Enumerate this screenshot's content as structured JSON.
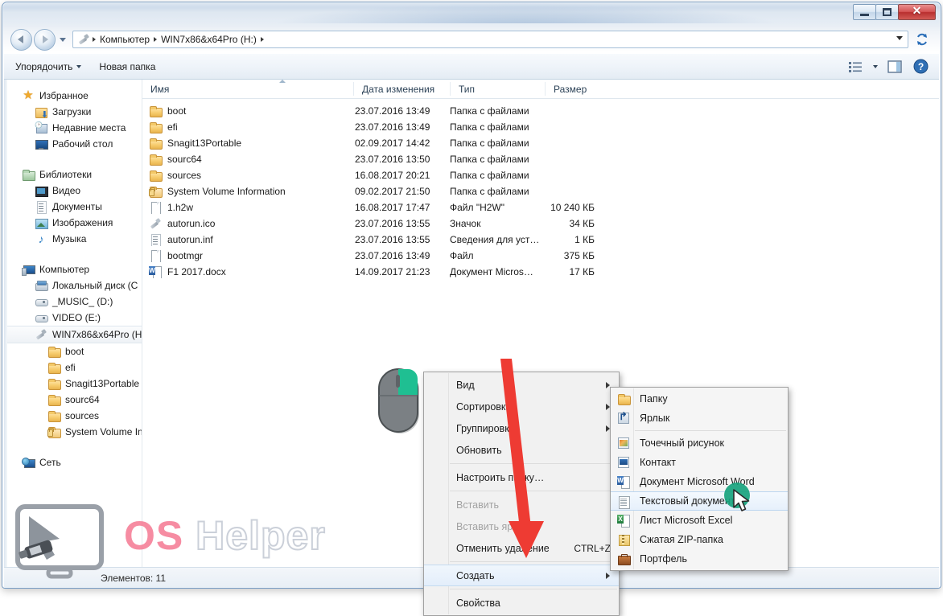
{
  "window": {
    "controls": {
      "minimize": "—",
      "maximize": "▭",
      "close": "✕"
    }
  },
  "address": {
    "icon": "usb-drive-icon",
    "crumbs": [
      "Компьютер",
      "WIN7x86&x64Pro (H:)"
    ],
    "dropdown_caret": "▾",
    "refresh": "refresh-icon"
  },
  "commandbar": {
    "organize": "Упорядочить",
    "new_folder": "Новая папка",
    "view_icon": "view-list-icon",
    "preview_icon": "preview-pane-icon",
    "help_icon": "help-icon"
  },
  "navpane": {
    "groups": [
      {
        "header": {
          "label": "Избранное",
          "icon": "star-icon"
        },
        "items": [
          {
            "label": "Загрузки",
            "icon": "downloads-icon"
          },
          {
            "label": "Недавние места",
            "icon": "recent-places-icon"
          },
          {
            "label": "Рабочий стол",
            "icon": "desktop-icon"
          }
        ]
      },
      {
        "header": {
          "label": "Библиотеки",
          "icon": "library-icon"
        },
        "items": [
          {
            "label": "Видео",
            "icon": "video-icon"
          },
          {
            "label": "Документы",
            "icon": "documents-icon"
          },
          {
            "label": "Изображения",
            "icon": "pictures-icon"
          },
          {
            "label": "Музыка",
            "icon": "music-icon"
          }
        ]
      },
      {
        "header": {
          "label": "Компьютер",
          "icon": "computer-icon"
        },
        "items": [
          {
            "label": "Локальный диск (C",
            "icon": "hdd-icon"
          },
          {
            "label": "_MUSIC_ (D:)",
            "icon": "drive-icon"
          },
          {
            "label": "VIDEO (E:)",
            "icon": "drive-icon"
          },
          {
            "label": "WIN7x86&x64Pro (H",
            "icon": "usb-drive-icon",
            "selected": true
          },
          {
            "label": "boot",
            "icon": "folder-icon",
            "depth": 2
          },
          {
            "label": "efi",
            "icon": "folder-icon",
            "depth": 2
          },
          {
            "label": "Snagit13Portable",
            "icon": "folder-icon",
            "depth": 2
          },
          {
            "label": "sourc64",
            "icon": "folder-icon",
            "depth": 2
          },
          {
            "label": "sources",
            "icon": "folder-icon",
            "depth": 2
          },
          {
            "label": "System Volume Inf",
            "icon": "folder-lock-icon",
            "depth": 2
          }
        ]
      },
      {
        "header": {
          "label": "Сеть",
          "icon": "network-icon"
        },
        "items": []
      }
    ]
  },
  "filelist": {
    "columns": [
      "Имя",
      "Дата изменения",
      "Тип",
      "Размер"
    ],
    "sort": {
      "column": "Имя",
      "direction": "ascending"
    },
    "rows": [
      {
        "name": "boot",
        "date": "23.07.2016 13:49",
        "type": "Папка с файлами",
        "size": "",
        "icon": "folder-icon"
      },
      {
        "name": "efi",
        "date": "23.07.2016 13:49",
        "type": "Папка с файлами",
        "size": "",
        "icon": "folder-icon"
      },
      {
        "name": "Snagit13Portable",
        "date": "02.09.2017 14:42",
        "type": "Папка с файлами",
        "size": "",
        "icon": "folder-icon"
      },
      {
        "name": "sourc64",
        "date": "23.07.2016 13:50",
        "type": "Папка с файлами",
        "size": "",
        "icon": "folder-icon"
      },
      {
        "name": "sources",
        "date": "16.08.2017 20:21",
        "type": "Папка с файлами",
        "size": "",
        "icon": "folder-icon"
      },
      {
        "name": "System Volume Information",
        "date": "09.02.2017 21:50",
        "type": "Папка с файлами",
        "size": "",
        "icon": "folder-lock-icon"
      },
      {
        "name": "1.h2w",
        "date": "16.08.2017 17:47",
        "type": "Файл \"H2W\"",
        "size": "10 240 КБ",
        "icon": "generic-file-icon"
      },
      {
        "name": "autorun.ico",
        "date": "23.07.2016 13:55",
        "type": "Значок",
        "size": "34 КБ",
        "icon": "icon-file-icon"
      },
      {
        "name": "autorun.inf",
        "date": "23.07.2016 13:55",
        "type": "Сведения для уст…",
        "size": "1 КБ",
        "icon": "inf-file-icon"
      },
      {
        "name": "bootmgr",
        "date": "23.07.2016 13:49",
        "type": "Файл",
        "size": "375 КБ",
        "icon": "generic-file-icon"
      },
      {
        "name": "F1 2017.docx",
        "date": "14.09.2017 21:23",
        "type": "Документ Micros…",
        "size": "17 КБ",
        "icon": "word-file-icon"
      }
    ]
  },
  "statusbar": {
    "text": "Элементов: 11"
  },
  "context_menu": {
    "items": [
      {
        "label": "Вид",
        "submenu": true
      },
      {
        "label": "Сортировка",
        "submenu": true
      },
      {
        "label": "Группировка",
        "submenu": true
      },
      {
        "label": "Обновить",
        "submenu": false
      },
      {
        "separator": true
      },
      {
        "label": "Настроить папку…",
        "submenu": false
      },
      {
        "separator": true
      },
      {
        "label": "Вставить",
        "disabled": true
      },
      {
        "label": "Вставить ярлык",
        "disabled": true
      },
      {
        "label": "Отменить удаление",
        "accel": "CTRL+Z"
      },
      {
        "separator": true
      },
      {
        "label": "Создать",
        "submenu": true,
        "highlight": true
      },
      {
        "separator": true
      },
      {
        "label": "Свойства",
        "submenu": false
      }
    ]
  },
  "submenu": {
    "items": [
      {
        "label": "Папку",
        "icon": "folder-icon"
      },
      {
        "label": "Ярлык",
        "icon": "shortcut-icon"
      },
      {
        "separator": true
      },
      {
        "label": "Точечный рисунок",
        "icon": "bitmap-icon"
      },
      {
        "label": "Контакт",
        "icon": "contact-icon"
      },
      {
        "label": "Документ Microsoft Word",
        "icon": "word-file-icon"
      },
      {
        "label": "Текстовый документ",
        "icon": "text-file-icon",
        "highlight": true
      },
      {
        "label": "Лист Microsoft Excel",
        "icon": "excel-file-icon"
      },
      {
        "label": "Сжатая ZIP-папка",
        "icon": "zip-folder-icon"
      },
      {
        "label": "Портфель",
        "icon": "briefcase-icon"
      }
    ]
  },
  "annotations": {
    "mouse_graphic": "computer-mouse-right-click-highlight",
    "red_arrow": "red-pointer-arrow",
    "cursor": "mouse-cursor-green-tap"
  },
  "watermark": {
    "part1": "OS",
    "part2": "Helper"
  },
  "colors": {
    "accent": "#2b5d9e",
    "highlight": "#e3eefb",
    "folder": "#f6cb6c",
    "close_button": "#d45454",
    "red_arrow": "#ee3b33",
    "green_tap": "#18a37e",
    "watermark_pink": "#f47892"
  }
}
